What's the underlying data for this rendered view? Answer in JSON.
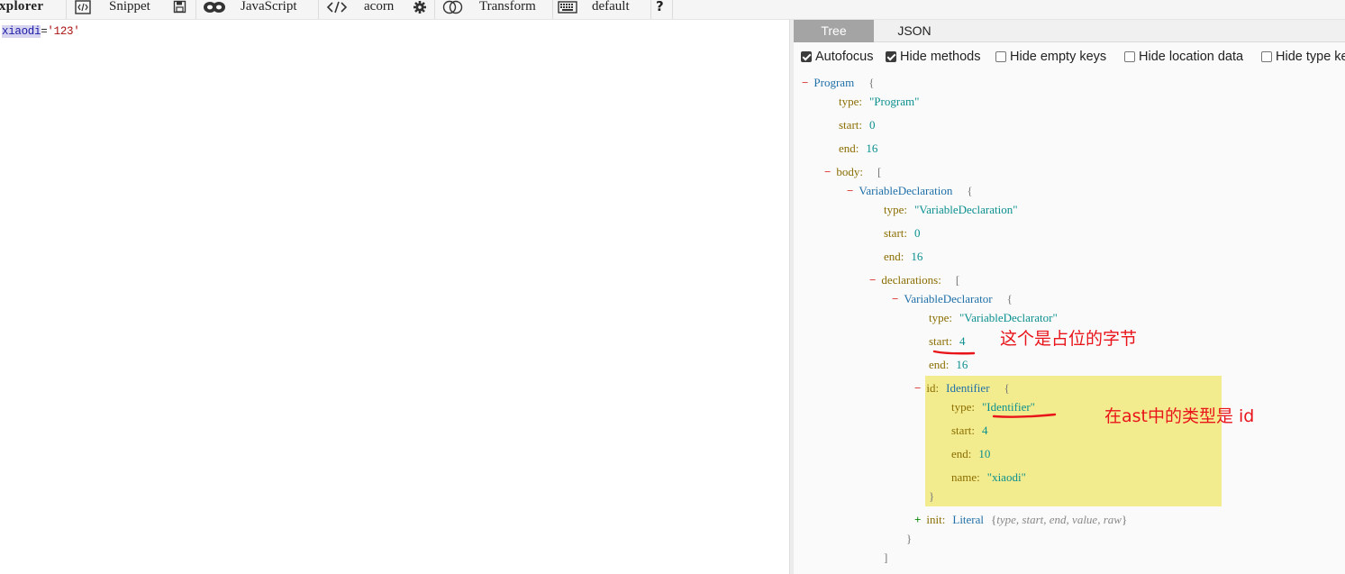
{
  "toolbar": {
    "app_title": "xplorer",
    "snippet_label": "Snippet",
    "language_label": "JavaScript",
    "parser_label": "acorn",
    "transform_label": "Transform",
    "keymap_label": "default",
    "help_label": "?"
  },
  "editor": {
    "code": {
      "identifier": "xiaodi",
      "operator": "=",
      "literal": "'123'"
    }
  },
  "output": {
    "tabs": [
      "Tree",
      "JSON"
    ],
    "active_tab": "Tree",
    "options": [
      {
        "label": "Autofocus",
        "checked": true
      },
      {
        "label": "Hide methods",
        "checked": true
      },
      {
        "label": "Hide empty keys",
        "checked": false
      },
      {
        "label": "Hide location data",
        "checked": false
      },
      {
        "label": "Hide type keys",
        "checked": false
      }
    ],
    "tree": {
      "program": {
        "name": "Program",
        "type": "\"Program\"",
        "start": "0",
        "end": "16"
      },
      "body_key": "body:",
      "var_decl": {
        "name": "VariableDeclaration",
        "type": "\"VariableDeclaration\"",
        "start": "0",
        "end": "16"
      },
      "declarations_key": "declarations:",
      "declarator": {
        "name": "VariableDeclarator",
        "type": "\"VariableDeclarator\"",
        "start": "4",
        "end": "16"
      },
      "id_node": {
        "key": "id:",
        "name": "Identifier",
        "type": "\"Identifier\"",
        "start": "4",
        "end": "10",
        "name_value": "\"xiaodi\""
      },
      "init_node": {
        "key": "init:",
        "name": "Literal",
        "summary": "type, start, end, value, raw"
      },
      "labels": {
        "type": "type:",
        "start": "start:",
        "end": "end:",
        "name": "name:"
      }
    }
  },
  "annotations": {
    "note_start": "这个是占位的字节",
    "note_type": "在ast中的类型是 id",
    "color": "#e8141a"
  },
  "colors": {
    "highlight": "#f3ec8f",
    "active_tab": "#a4a4a4"
  }
}
